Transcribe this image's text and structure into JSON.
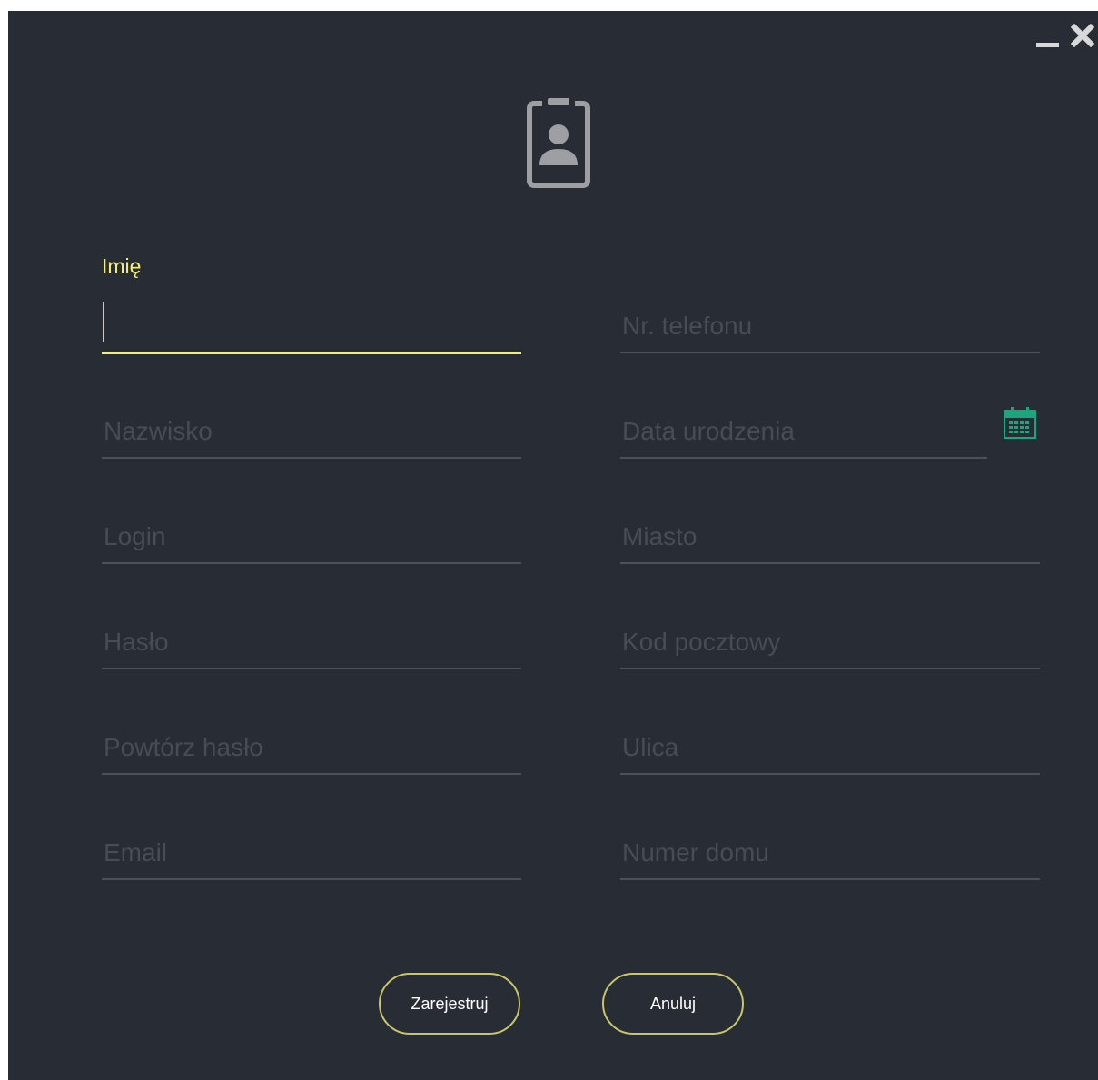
{
  "window": {
    "controls": {
      "minimize_icon": "minimize-icon",
      "close_icon": "close-icon"
    }
  },
  "header_icon": "id-badge-icon",
  "form": {
    "left": [
      {
        "label": "Imię",
        "value": "",
        "active": true
      },
      {
        "placeholder": "Nazwisko"
      },
      {
        "placeholder": "Login"
      },
      {
        "placeholder": "Hasło"
      },
      {
        "placeholder": "Powtórz hasło"
      },
      {
        "placeholder": "Email"
      }
    ],
    "right": [
      {
        "placeholder": "Nr. telefonu"
      },
      {
        "placeholder": "Data urodzenia",
        "icon": "calendar-icon"
      },
      {
        "placeholder": "Miasto"
      },
      {
        "placeholder": "Kod pocztowy"
      },
      {
        "placeholder": "Ulica"
      },
      {
        "placeholder": "Numer domu"
      }
    ]
  },
  "actions": {
    "register_label": "Zarejestruj",
    "cancel_label": "Anuluj"
  },
  "colors": {
    "background": "#282c35",
    "accent": "#f1ee7d",
    "calendar_icon": "#1aa67f",
    "button_border": "#c9c66a"
  }
}
